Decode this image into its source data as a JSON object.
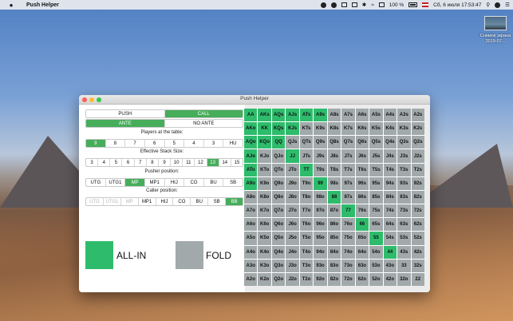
{
  "menubar": {
    "app_name": "Push Helper",
    "battery": "100 %",
    "datetime": "Сб, 6 июля  17:53:47"
  },
  "desktop_icon": {
    "label": "Снимок экрана 2019-07..."
  },
  "window": {
    "title": "Push Helper"
  },
  "mode": {
    "options": [
      "PUSH",
      "CALL"
    ],
    "selected": "CALL"
  },
  "ante": {
    "options": [
      "ANTE",
      "NO ANTE"
    ],
    "selected": "ANTE"
  },
  "players": {
    "label": "Players at the table:",
    "options": [
      "9",
      "8",
      "7",
      "6",
      "5",
      "4",
      "3",
      "HU"
    ],
    "selected": "9"
  },
  "stack": {
    "label": "Effective Stack Size:",
    "options": [
      "3",
      "4",
      "5",
      "6",
      "7",
      "8",
      "9",
      "10",
      "11",
      "12",
      "13",
      "14",
      "15"
    ],
    "selected": "13"
  },
  "pusher": {
    "label": "Pusher position:",
    "options": [
      "UTG",
      "UTG1",
      "MP",
      "MP1",
      "HIJ",
      "CO",
      "BU",
      "SB"
    ],
    "selected": "MP"
  },
  "caller": {
    "label": "Caller position:",
    "options": [
      "UTG",
      "UTG1",
      "MP",
      "MP1",
      "HIJ",
      "CO",
      "BU",
      "SB",
      "BB"
    ],
    "selected": "BB",
    "disabled": [
      "UTG",
      "UTG1",
      "MP"
    ]
  },
  "legend": {
    "allin": "ALL-IN",
    "fold": "FOLD",
    "allin_color": "#2ebc6c",
    "fold_color": "#a2a9aa"
  },
  "hands": [
    [
      "AA",
      "AKs",
      "AQs",
      "AJs",
      "ATs",
      "A9s",
      "A8s",
      "A7s",
      "A6s",
      "A5s",
      "A4s",
      "A3s",
      "A2s"
    ],
    [
      "AKo",
      "KK",
      "KQs",
      "KJs",
      "KTs",
      "K9s",
      "K8s",
      "K7s",
      "K6s",
      "K5s",
      "K4s",
      "K3s",
      "K2s"
    ],
    [
      "AQo",
      "KQo",
      "QQ",
      "QJs",
      "QTs",
      "Q9s",
      "Q8s",
      "Q7s",
      "Q6s",
      "Q5s",
      "Q4s",
      "Q3s",
      "Q2s"
    ],
    [
      "AJo",
      "KJo",
      "QJo",
      "JJ",
      "JTs",
      "J9s",
      "J8s",
      "J7s",
      "J6s",
      "J5s",
      "J4s",
      "J3s",
      "J2s"
    ],
    [
      "ATo",
      "KTo",
      "QTo",
      "JTo",
      "TT",
      "T9s",
      "T8s",
      "T7s",
      "T6s",
      "T5s",
      "T4s",
      "T3s",
      "T2s"
    ],
    [
      "A9o",
      "K9o",
      "Q9o",
      "J9o",
      "T9o",
      "99",
      "98s",
      "97s",
      "96s",
      "95s",
      "94s",
      "93s",
      "92s"
    ],
    [
      "A8o",
      "K8o",
      "Q8o",
      "J8o",
      "T8o",
      "98o",
      "88",
      "87s",
      "86s",
      "85s",
      "84s",
      "83s",
      "82s"
    ],
    [
      "A7o",
      "K7o",
      "Q7o",
      "J7o",
      "T7o",
      "97o",
      "87o",
      "77",
      "76s",
      "75s",
      "74s",
      "73s",
      "72s"
    ],
    [
      "A6o",
      "K6o",
      "Q6o",
      "J6o",
      "T6o",
      "96o",
      "86o",
      "76o",
      "66",
      "65s",
      "64s",
      "63s",
      "62s"
    ],
    [
      "A5o",
      "K5o",
      "Q5o",
      "J5o",
      "T5o",
      "95o",
      "85o",
      "75o",
      "65o",
      "55",
      "54s",
      "53s",
      "52s"
    ],
    [
      "A4o",
      "K4o",
      "Q4o",
      "J4o",
      "T4o",
      "94o",
      "84o",
      "74o",
      "64o",
      "54o",
      "44",
      "43s",
      "42s"
    ],
    [
      "A3o",
      "K3o",
      "Q3o",
      "J3o",
      "T3o",
      "93o",
      "83o",
      "73o",
      "63o",
      "53o",
      "43o",
      "33",
      "32s"
    ],
    [
      "A2o",
      "K2o",
      "Q2o",
      "J2o",
      "T2o",
      "92o",
      "82o",
      "72o",
      "62o",
      "52o",
      "42o",
      "32o",
      "22"
    ]
  ],
  "allin_hands": [
    "AA",
    "AKs",
    "AQs",
    "AJs",
    "ATs",
    "A9s",
    "AKo",
    "KK",
    "KQs",
    "KJs",
    "AQo",
    "KQo",
    "QQ",
    "AJo",
    "JJ",
    "ATo",
    "TT",
    "A9o",
    "99",
    "88",
    "77",
    "66",
    "55",
    "44"
  ]
}
